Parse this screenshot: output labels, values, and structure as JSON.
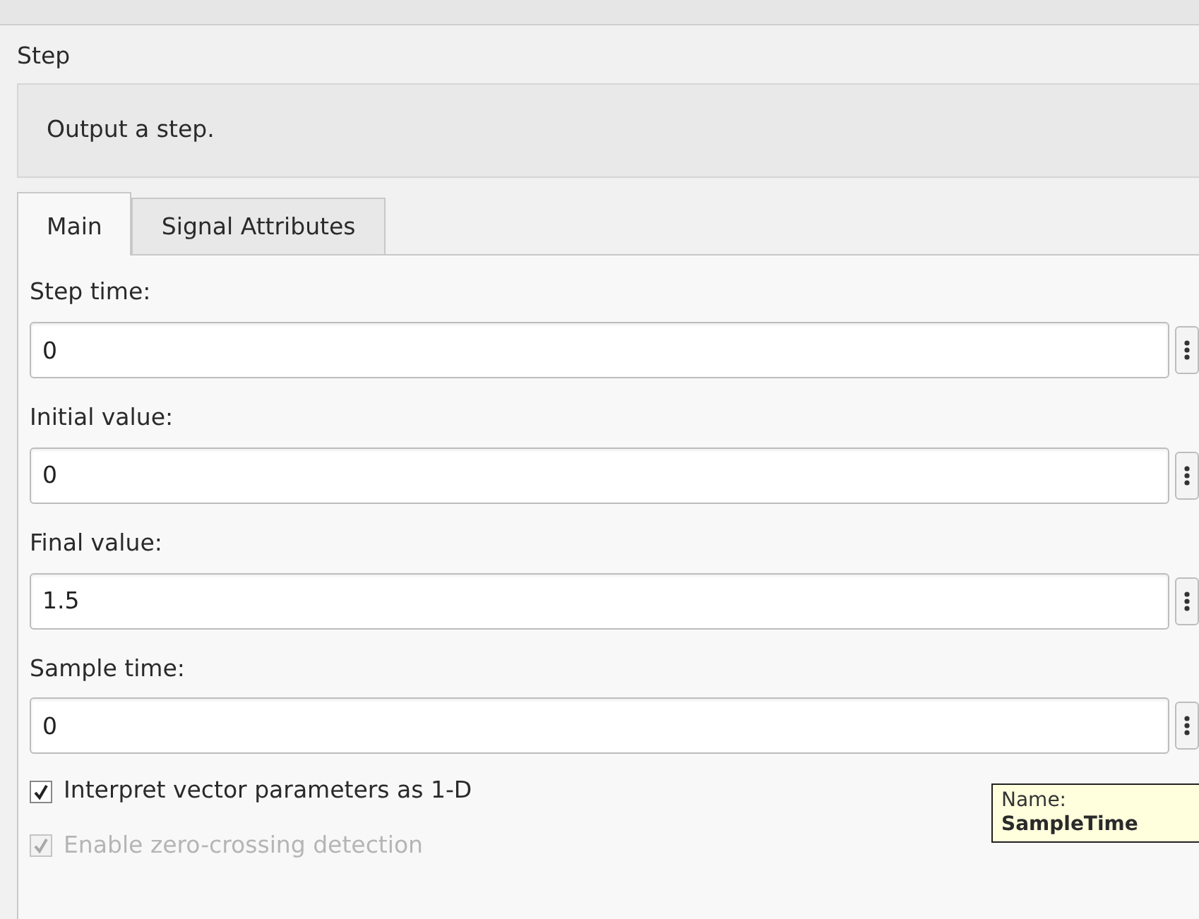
{
  "block": {
    "title": "Step",
    "description": "Output a step."
  },
  "tabs": [
    {
      "label": "Main",
      "selected": true
    },
    {
      "label": "Signal Attributes",
      "selected": false
    }
  ],
  "parameters": [
    {
      "label": "Step time:",
      "value": "0"
    },
    {
      "label": "Initial value:",
      "value": "0"
    },
    {
      "label": "Final value:",
      "value": "1.5"
    },
    {
      "label": "Sample time:",
      "value": "0"
    }
  ],
  "checkboxes": [
    {
      "label": "Interpret vector parameters as 1-D",
      "checked": true,
      "disabled": false
    },
    {
      "label": "Enable zero-crossing detection",
      "checked": true,
      "disabled": true
    }
  ],
  "tooltip": {
    "label": "Name:",
    "value": "SampleTime"
  }
}
